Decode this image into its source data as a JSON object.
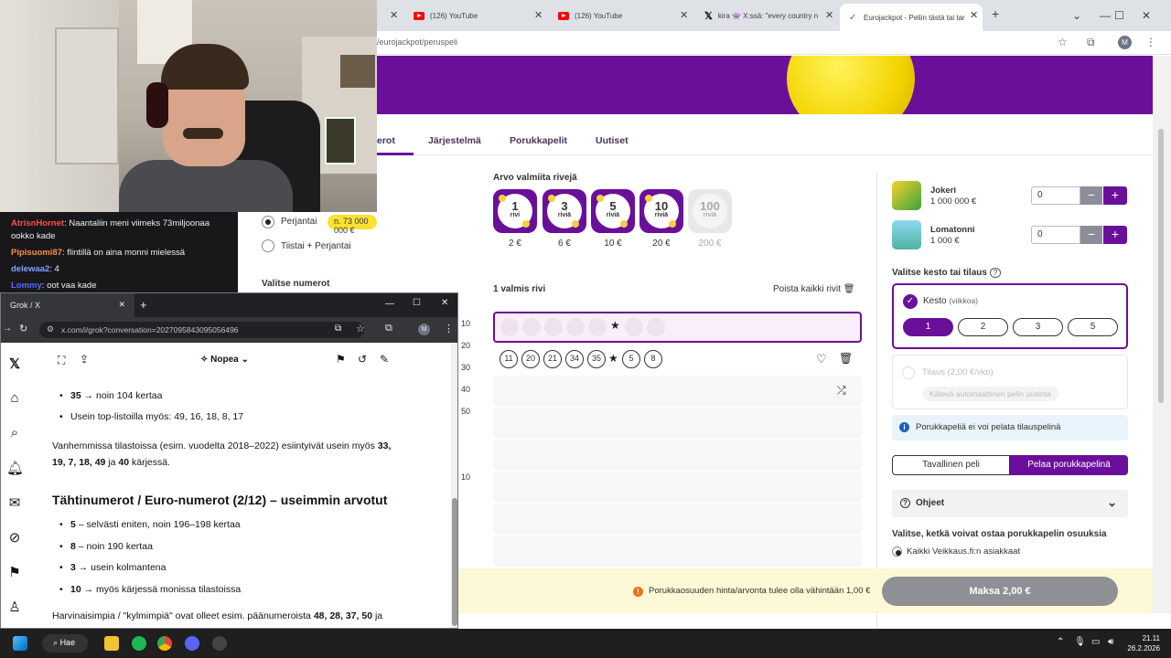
{
  "chat": {
    "messages": [
      {
        "user": "AtrisnHornet",
        "text": "Naantaliin meni viimeks 73miljoonaa ookko kade"
      },
      {
        "user": "Pipisuomi87",
        "text": "flintillä on aina monni mielessä"
      },
      {
        "user": "delewaa2",
        "text": "4"
      },
      {
        "user": "Lommy",
        "text": "oot vaa kade"
      }
    ]
  },
  "chrome": {
    "tabs": [
      {
        "title": "(126) YouTube"
      },
      {
        "title": "(126) YouTube"
      },
      {
        "title": "kira 👾 X:ssä: \"every country n"
      },
      {
        "title": "Eurojackpot - Peliin tästä tai tar"
      }
    ],
    "url": "/eurojackpot/peruspeli",
    "profile_initial": "M"
  },
  "page": {
    "nav": [
      "Numerot",
      "Järjestelmä",
      "Porukkapelit",
      "Uutiset"
    ],
    "nav_visible": [
      "erot",
      "Järjestelmä",
      "Porukkapelit",
      "Uutiset"
    ],
    "draw_options": [
      {
        "label": "Perjantai",
        "badge": "n. 73 000 000 €",
        "selected": true
      },
      {
        "label": "Tiistai + Perjantai",
        "selected": false
      }
    ],
    "choose_numbers": "Valitse numerot",
    "ready_lines_title": "Arvo valmiita rivejä",
    "packs": [
      {
        "num": "1",
        "label": "rivi",
        "price": "2 €",
        "disabled": false
      },
      {
        "num": "3",
        "label": "riviä",
        "price": "6 €",
        "disabled": false
      },
      {
        "num": "5",
        "label": "riviä",
        "price": "10 €",
        "disabled": false
      },
      {
        "num": "10",
        "label": "riviä",
        "price": "20 €",
        "disabled": false
      },
      {
        "num": "100",
        "label": "riviä",
        "price": "200 €",
        "disabled": true
      }
    ],
    "lines_count": "1 valmis rivi",
    "clear_all": "Poista kaikki rivit",
    "line_numbers": [
      "11",
      "20",
      "21",
      "34",
      "35"
    ],
    "line_stars": [
      "5",
      "8"
    ],
    "side_numbers": [
      "10",
      "20",
      "30",
      "40",
      "50",
      "10"
    ],
    "right": {
      "products": [
        {
          "name": "Jokeri",
          "sub": "1 000 000 €",
          "value": "0"
        },
        {
          "name": "Lomatonni",
          "sub": "1 000 €",
          "value": "0"
        }
      ],
      "duration_title": "Valitse kesto tai tilaus",
      "kesto": "Kesto",
      "kesto_unit": "(viikkoa)",
      "weeks": [
        "1",
        "2",
        "3",
        "5"
      ],
      "subscription": "Tilaus (2,00 €/vko)",
      "subscription_note": "Kätevä automaattinen pelin uusinta",
      "info": "Porukkapeliä ei voi pelata tilauspelinä",
      "mode_normal": "Tavallinen peli",
      "mode_group": "Pelaa porukkapelinä",
      "help": "Ohjeet",
      "buyers_title": "Valitse, ketkä voivat ostaa porukkapelin osuuksia",
      "buyers_option": "Kaikki Veikkaus.fi:n asiakkaat"
    },
    "pay_warning": "Porukkaosuuden hinta/arvonta tulee olla vähintään 1,00 €",
    "pay_button": "Maksa 2,00 €"
  },
  "grok": {
    "tab_title": "Grok / X",
    "url": "x.com/i/grok?conversation=2027095843095056496",
    "mode": "Nopea",
    "items_top": [
      {
        "bold": "35",
        "text": " → noin 104 kertaa"
      },
      {
        "bold": "",
        "text": "Usein top-listoilla myös: 49, 16, 18, 8, 17"
      }
    ],
    "para1": "Vanhemmissa tilastoissa (esim. vuodelta 2018–2022) esiintyivät usein myös",
    "para1_bold": "33, 19, 7, 18, 49",
    "para1_mid": " ja ",
    "para1_bold2": "40",
    "para1_end": " kärjessä.",
    "heading": "Tähtinumerot / Euro-numerot (2/12) – useimmin arvotut",
    "stars": [
      {
        "bold": "5",
        "text": " – selvästi eniten, noin 196–198 kertaa"
      },
      {
        "bold": "8",
        "text": " – noin 190 kertaa"
      },
      {
        "bold": "3",
        "text": " → usein kolmantena"
      },
      {
        "bold": "10",
        "text": " → myös kärjessä monissa tilastoissa"
      }
    ],
    "para2": "Harvinaisimpia / \"kylmimpiä\" ovat olleet esim. päänumeroista ",
    "para2_bold": "48, 28, 37, 50",
    "para2_end": " ja"
  },
  "taskbar": {
    "search": "Hae",
    "time": "21.11",
    "date": "26.2.2026"
  }
}
